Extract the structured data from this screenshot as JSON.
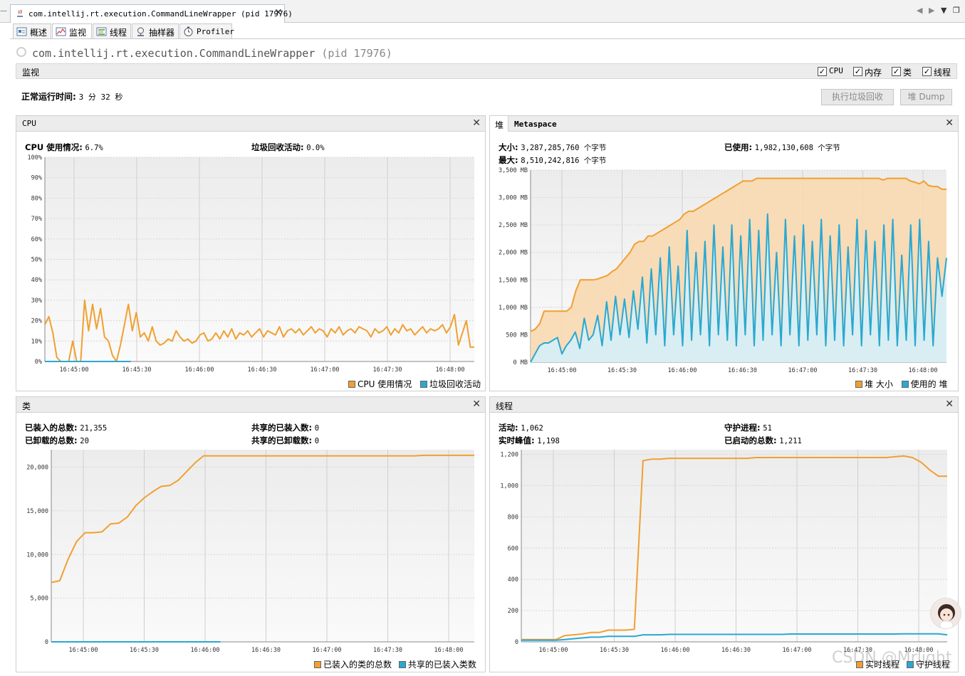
{
  "doc_tab": {
    "label": "com.intellij.rt.execution.CommandLineWrapper (pid 17976)",
    "close": "✕"
  },
  "window_controls": {
    "prev": "◀",
    "next": "▶",
    "menu": "▼",
    "restore": "❐"
  },
  "left_edge": {
    "glyph": "—"
  },
  "view_tabs": [
    {
      "label": "概述",
      "icon": "overview-icon"
    },
    {
      "label": "监视",
      "icon": "monitor-icon",
      "active": true
    },
    {
      "label": "线程",
      "icon": "threads-icon"
    },
    {
      "label": "抽样器",
      "icon": "sampler-icon"
    },
    {
      "label": "Profiler",
      "icon": "profiler-icon"
    }
  ],
  "header": {
    "process_name": "com.intellij.rt.execution.CommandLineWrapper",
    "pid": "(pid 17976)"
  },
  "monitor_bar": {
    "label": "监视",
    "checkboxes": [
      {
        "label": "CPU",
        "checked": true
      },
      {
        "label": "内存",
        "checked": true
      },
      {
        "label": "类",
        "checked": true
      },
      {
        "label": "线程",
        "checked": true
      }
    ]
  },
  "uptime": {
    "label": "正常运行时间:",
    "value": "3 分 32 秒"
  },
  "buttons": {
    "gc": "执行垃圾回收",
    "heap_dump": "堆 Dump"
  },
  "colors": {
    "orange": "#f0a030",
    "blue": "#2aa8d0",
    "heap_fill": "#f8d8b0",
    "used_fill": "#d4f0fa"
  },
  "cpu_panel": {
    "title": "CPU",
    "close": "✕",
    "usage_label": "CPU 使用情况:",
    "usage_value": "6.7%",
    "gc_label": "垃圾回收活动:",
    "gc_value": "0.0%",
    "legend": [
      "CPU 使用情况",
      "垃圾回收活动"
    ]
  },
  "heap_panel": {
    "tab_heap": "堆",
    "tab_meta": "Metaspace",
    "close": "✕",
    "size_label": "大小:",
    "size_value": "3,287,285,760 个字节",
    "max_label": "最大:",
    "max_value": "8,510,242,816 个字节",
    "used_label": "已使用:",
    "used_value": "1,982,130,608 个字节",
    "legend": [
      "堆 大小",
      "使用的 堆"
    ]
  },
  "classes_panel": {
    "title": "类",
    "close": "✕",
    "loaded_label": "已装入的总数:",
    "loaded_value": "21,355",
    "unloaded_label": "已卸载的总数:",
    "unloaded_value": "20",
    "shared_loaded_label": "共享的已装入数:",
    "shared_loaded_value": "0",
    "shared_unloaded_label": "共享的已卸载数:",
    "shared_unloaded_value": "0",
    "legend": [
      "已装入的类的总数",
      "共享的已装入类数"
    ]
  },
  "threads_panel": {
    "title": "线程",
    "close": "✕",
    "live_label": "活动:",
    "live_value": "1,062",
    "peak_label": "实时峰值:",
    "peak_value": "1,198",
    "daemon_label": "守护进程:",
    "daemon_value": "51",
    "started_label": "已启动的总数:",
    "started_value": "1,211",
    "legend": [
      "实时线程",
      "守护线程"
    ]
  },
  "watermark": "CSDN @Mrlight",
  "chart_data": [
    {
      "type": "line",
      "name": "cpu",
      "x_ticks": [
        "16:45:00",
        "16:45:30",
        "16:46:00",
        "16:46:30",
        "16:47:00",
        "16:47:30",
        "16:48:00"
      ],
      "y_ticks": [
        "0%",
        "10%",
        "20%",
        "30%",
        "40%",
        "50%",
        "60%",
        "70%",
        "80%",
        "90%",
        "100%"
      ],
      "ylim": [
        0,
        100
      ],
      "series": [
        {
          "name": "CPU 使用情况",
          "color": "#f0a030",
          "values": [
            18,
            22,
            14,
            2,
            0,
            0,
            0,
            10,
            0,
            0,
            30,
            15,
            28,
            16,
            26,
            12,
            10,
            3,
            0,
            8,
            18,
            28,
            15,
            24,
            12,
            14,
            10,
            17,
            10,
            8,
            9,
            11,
            10,
            15,
            12,
            10,
            11,
            9,
            10,
            13,
            14,
            10,
            11,
            14,
            11,
            15,
            12,
            16,
            11,
            14,
            13,
            15,
            12,
            14,
            16,
            12,
            15,
            14,
            13,
            17,
            12,
            15,
            16,
            14,
            16,
            13,
            15,
            17,
            14,
            16,
            15,
            12,
            16,
            14,
            17,
            13,
            15,
            16,
            14,
            17,
            16,
            15,
            12,
            16,
            14,
            15,
            17,
            13,
            16,
            14,
            18,
            15,
            16,
            13,
            15,
            17,
            14,
            16,
            15,
            16,
            18,
            14,
            17,
            23,
            8,
            14,
            20,
            7,
            7
          ]
        },
        {
          "name": "垃圾回收活动",
          "color": "#2aa8d0",
          "values": [
            0,
            0,
            0,
            0,
            0,
            0,
            0,
            0,
            0,
            0,
            0,
            0,
            0,
            0,
            0,
            0,
            0,
            0,
            0,
            0,
            0,
            0,
            0,
            0,
            0,
            0,
            0,
            0,
            0,
            0,
            0,
            0,
            0,
            0,
            0,
            0,
            0,
            0,
            0,
            0
          ]
        }
      ]
    },
    {
      "type": "area",
      "name": "heap",
      "x_ticks": [
        "16:45:00",
        "16:45:30",
        "16:46:00",
        "16:46:30",
        "16:47:00",
        "16:47:30",
        "16:48:00"
      ],
      "y_ticks": [
        "0 MB",
        "500 MB",
        "1,000 MB",
        "1,500 MB",
        "2,000 MB",
        "2,500 MB",
        "3,000 MB",
        "3,500 MB"
      ],
      "ylim": [
        0,
        3500
      ],
      "series": [
        {
          "name": "堆 大小",
          "color": "#f0a030",
          "values": [
            560,
            600,
            700,
            930,
            930,
            930,
            930,
            930,
            930,
            1000,
            1300,
            1500,
            1500,
            1500,
            1500,
            1520,
            1550,
            1580,
            1650,
            1700,
            1800,
            1900,
            2000,
            2150,
            2200,
            2200,
            2300,
            2300,
            2350,
            2400,
            2450,
            2500,
            2550,
            2600,
            2700,
            2750,
            2750,
            2800,
            2850,
            2900,
            2950,
            3000,
            3050,
            3100,
            3150,
            3200,
            3250,
            3300,
            3300,
            3300,
            3350,
            3350,
            3350,
            3350,
            3350,
            3350,
            3350,
            3350,
            3350,
            3350,
            3350,
            3350,
            3350,
            3350,
            3350,
            3350,
            3350,
            3350,
            3350,
            3350,
            3350,
            3350,
            3350,
            3350,
            3350,
            3350,
            3350,
            3350,
            3320,
            3350,
            3350,
            3350,
            3350,
            3350,
            3300,
            3280,
            3250,
            3300,
            3220,
            3200,
            3200,
            3150,
            3150
          ]
        },
        {
          "name": "使用的 堆",
          "color": "#2aa8d0",
          "values": [
            0,
            150,
            300,
            350,
            350,
            400,
            450,
            150,
            300,
            400,
            550,
            250,
            800,
            400,
            500,
            850,
            300,
            1100,
            400,
            1200,
            500,
            1150,
            450,
            1300,
            600,
            1550,
            350,
            1700,
            500,
            1900,
            300,
            2100,
            500,
            1750,
            300,
            2400,
            400,
            2000,
            500,
            2200,
            300,
            2500,
            500,
            2100,
            400,
            2500,
            300,
            2300,
            500,
            2600,
            300,
            2400,
            400,
            2700,
            500,
            2000,
            300,
            2600,
            500,
            2300,
            300,
            2500,
            400,
            2200,
            500,
            2600,
            300,
            2300,
            400,
            2500,
            300,
            2100,
            500,
            2600,
            300,
            2400,
            500,
            2200,
            300,
            2500,
            400,
            2600,
            300,
            1950,
            400,
            2500,
            300,
            2600,
            400,
            2200,
            300,
            1900,
            1200,
            1900
          ]
        }
      ]
    },
    {
      "type": "line",
      "name": "classes",
      "x_ticks": [
        "16:45:00",
        "16:45:30",
        "16:46:00",
        "16:46:30",
        "16:47:00",
        "16:47:30",
        "16:48:00"
      ],
      "y_ticks": [
        "0",
        "5,000",
        "10,000",
        "15,000",
        "20,000"
      ],
      "ylim": [
        0,
        22000
      ],
      "series": [
        {
          "name": "已装入的类的总数",
          "color": "#f0a030",
          "values": [
            6800,
            7000,
            9500,
            11500,
            12500,
            12500,
            12600,
            13500,
            13600,
            14300,
            15600,
            16500,
            17200,
            17800,
            17900,
            18500,
            19500,
            20500,
            21300,
            21300,
            21300,
            21300,
            21300,
            21300,
            21300,
            21300,
            21300,
            21300,
            21300,
            21300,
            21300,
            21300,
            21300,
            21300,
            21300,
            21300,
            21300,
            21300,
            21300,
            21300,
            21300,
            21300,
            21300,
            21300,
            21355,
            21355,
            21355,
            21355,
            21355,
            21355,
            21355
          ]
        },
        {
          "name": "共享的已装入类数",
          "color": "#2aa8d0",
          "values": [
            0,
            0,
            0,
            0,
            0,
            0,
            0,
            0,
            0,
            0,
            0,
            0,
            0,
            0,
            0,
            0,
            0,
            0,
            0,
            0
          ]
        }
      ]
    },
    {
      "type": "line",
      "name": "threads",
      "x_ticks": [
        "16:45:00",
        "16:45:30",
        "16:46:00",
        "16:46:30",
        "16:47:00",
        "16:47:30",
        "16:48:00"
      ],
      "y_ticks": [
        "0",
        "200",
        "400",
        "600",
        "800",
        "1,000",
        "1,200"
      ],
      "ylim": [
        0,
        1230
      ],
      "series": [
        {
          "name": "实时线程",
          "color": "#f0a030",
          "values": [
            15,
            15,
            15,
            15,
            15,
            40,
            45,
            50,
            60,
            60,
            75,
            75,
            75,
            80,
            1160,
            1170,
            1170,
            1175,
            1175,
            1175,
            1175,
            1175,
            1175,
            1175,
            1175,
            1175,
            1175,
            1180,
            1180,
            1180,
            1180,
            1180,
            1180,
            1180,
            1180,
            1180,
            1180,
            1180,
            1180,
            1180,
            1180,
            1180,
            1180,
            1185,
            1190,
            1180,
            1150,
            1100,
            1060,
            1060
          ]
        },
        {
          "name": "守护线程",
          "color": "#2aa8d0",
          "values": [
            10,
            10,
            10,
            10,
            10,
            15,
            20,
            25,
            30,
            30,
            35,
            35,
            35,
            35,
            45,
            45,
            45,
            48,
            48,
            48,
            48,
            48,
            48,
            48,
            48,
            48,
            48,
            48,
            48,
            48,
            48,
            50,
            50,
            50,
            50,
            50,
            50,
            50,
            50,
            50,
            50,
            50,
            50,
            50,
            51,
            51,
            51,
            51,
            51,
            45
          ]
        }
      ]
    }
  ]
}
